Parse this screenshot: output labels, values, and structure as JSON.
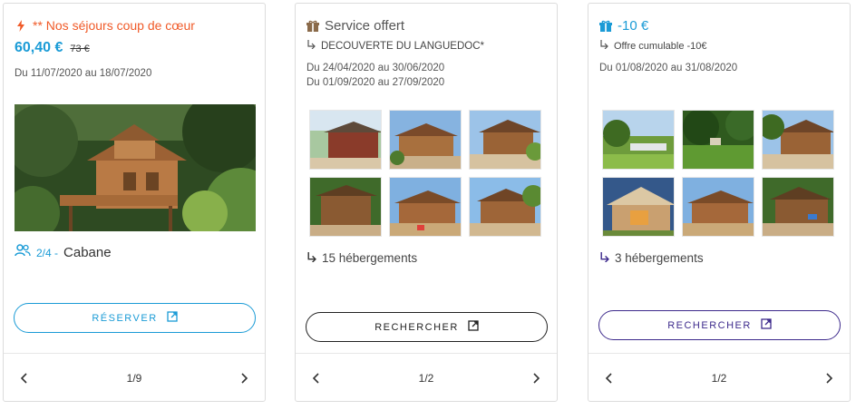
{
  "cards": [
    {
      "header": "** Nos séjours coup de cœur",
      "price": "60,40 €",
      "old_price": "73 €",
      "dates": [
        "Du 11/07/2020 au 18/07/2020"
      ],
      "capacity": "2/4 -",
      "accommodation_type": "Cabane",
      "button_label": "RÉSERVER",
      "pager": "1/9",
      "colors": {
        "accent": "#f05a28",
        "link": "#1a9bd6"
      }
    },
    {
      "header": "Service offert",
      "subtitle": "DECOUVERTE DU LANGUEDOC*",
      "dates": [
        "Du 24/04/2020 au 30/06/2020",
        "Du 01/09/2020 au 27/09/2020"
      ],
      "count_label": "15 hébergements",
      "button_label": "RECHERCHER",
      "pager": "1/2",
      "colors": {
        "icon": "#8a6a4a",
        "button": "#222222"
      }
    },
    {
      "header": "-10 €",
      "subtitle": "Offre cumulable -10€",
      "dates": [
        "Du 01/08/2020 au 31/08/2020"
      ],
      "count_label": "3 hébergements",
      "button_label": "RECHERCHER",
      "pager": "1/2",
      "colors": {
        "icon": "#1a9bd6",
        "button": "#3d2a8c"
      }
    }
  ]
}
